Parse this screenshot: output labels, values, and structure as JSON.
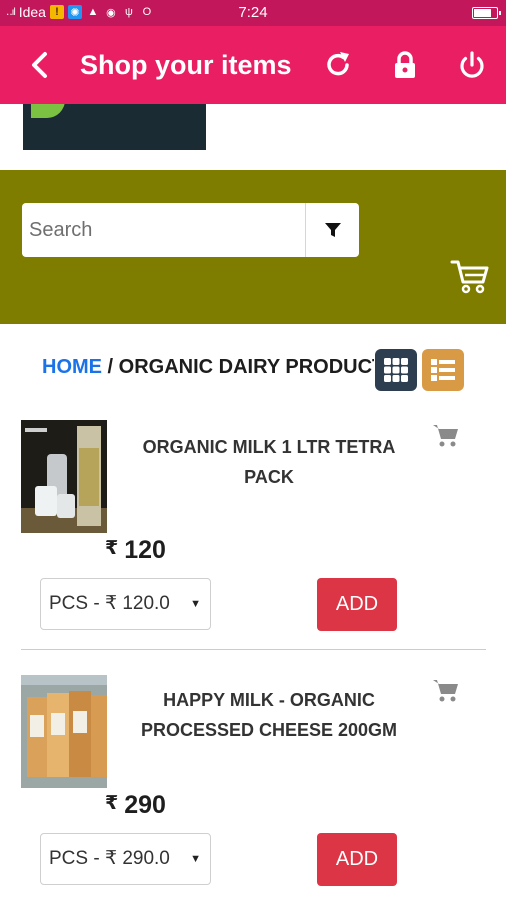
{
  "status_bar": {
    "signal": "‥ıl",
    "carrier": "Idea",
    "icons": [
      "sim-icon",
      "app-icon",
      "warning-icon",
      "cat-icon",
      "usb-icon",
      "sync-icon"
    ],
    "time": "7:24",
    "battery_level": 0.75
  },
  "app_bar": {
    "title": "Shop your items",
    "color": "#e91e63",
    "actions": [
      "refresh-icon",
      "lock-icon",
      "power-icon"
    ]
  },
  "search": {
    "placeholder": "Search",
    "band_color": "#7f7d00"
  },
  "breadcrumb": {
    "home": "HOME",
    "separator": " / ",
    "current": "ORGANIC DAIRY PRODUCTS"
  },
  "view_toggle": {
    "grid_color": "#2c3e50",
    "list_color": "#d99a45"
  },
  "products": [
    {
      "name": "ORGANIC MILK 1 LTR TETRA PACK",
      "currency": "₹",
      "price": "120",
      "unit_option": "PCS - ₹ 120.0",
      "add_label": "ADD"
    },
    {
      "name": "HAPPY MILK - ORGANIC PROCESSED CHEESE 200GM",
      "currency": "₹",
      "price": "290",
      "unit_option": "PCS - ₹ 290.0",
      "add_label": "ADD"
    }
  ]
}
